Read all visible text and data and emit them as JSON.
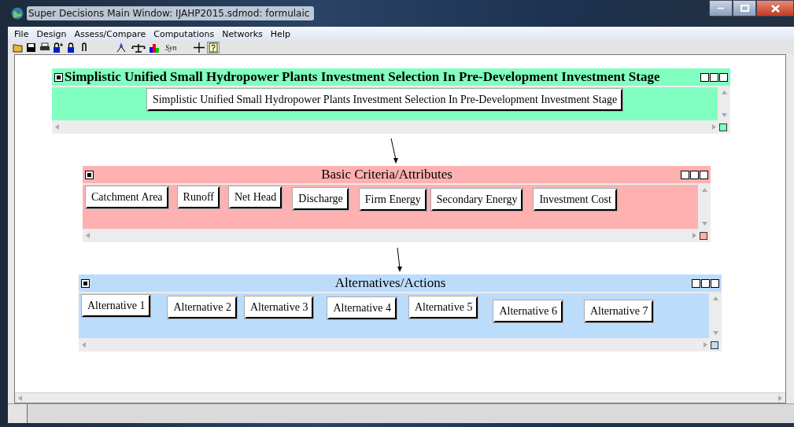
{
  "window": {
    "title": "Super Decisions Main Window: IJAHP2015.sdmod: formulaic"
  },
  "menu": [
    "File",
    "Design",
    "Assess/Compare",
    "Computations",
    "Networks",
    "Help"
  ],
  "toolbar": {
    "syn_label": "Syn"
  },
  "clusters": [
    {
      "kind": "goal",
      "title": "Simplistic Unified Small Hydropower Plants Investment Selection In Pre-Development Investment Stage",
      "color": "#80ffc0",
      "nodes": [
        "Simplistic Unified Small Hydropower Plants Investment Selection In Pre-Development Investment Stage"
      ]
    },
    {
      "kind": "cluster",
      "title": "Basic Criteria/Attributes",
      "color": "#ffb0b0",
      "nodes": [
        "Catchment Area",
        "Runoff",
        "Net Head",
        "Discharge",
        "Firm Energy",
        "Secondary Energy",
        "Investment Cost"
      ]
    },
    {
      "kind": "cluster",
      "title": "Alternatives/Actions",
      "color": "#bcdcfc",
      "nodes": [
        "Alternative 1",
        "Alternative 2",
        "Alternative 3",
        "Alternative 4",
        "Alternative 5",
        "Alternative 6",
        "Alternative 7"
      ]
    }
  ]
}
